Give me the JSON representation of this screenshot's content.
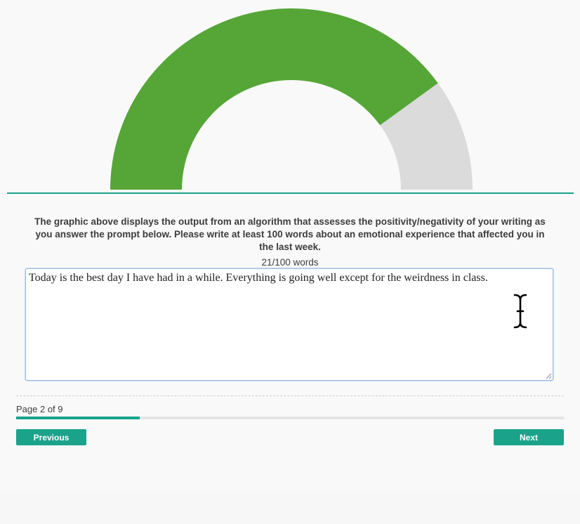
{
  "gauge": {
    "value_fraction": 0.8,
    "filled_color": "#55a637",
    "remaining_color": "#dbdbdb"
  },
  "prompt": {
    "text": "The graphic above displays the output from an algorithm that assesses the positivity/negativity of your writing as you answer the prompt below. Please write at least 100 words about an emotional experience that affected you in the last week."
  },
  "word_count": {
    "text": "21/100 words"
  },
  "answer": {
    "value": "Today is the best day I have had in a while. Everything is going well except for the weirdness in class. "
  },
  "pagination": {
    "label": "Page 2 of 9",
    "progress_fraction": 0.2262
  },
  "buttons": {
    "previous": "Previous",
    "next": "Next"
  },
  "colors": {
    "accent": "#1aa38a",
    "text": "#3c3c3c"
  }
}
